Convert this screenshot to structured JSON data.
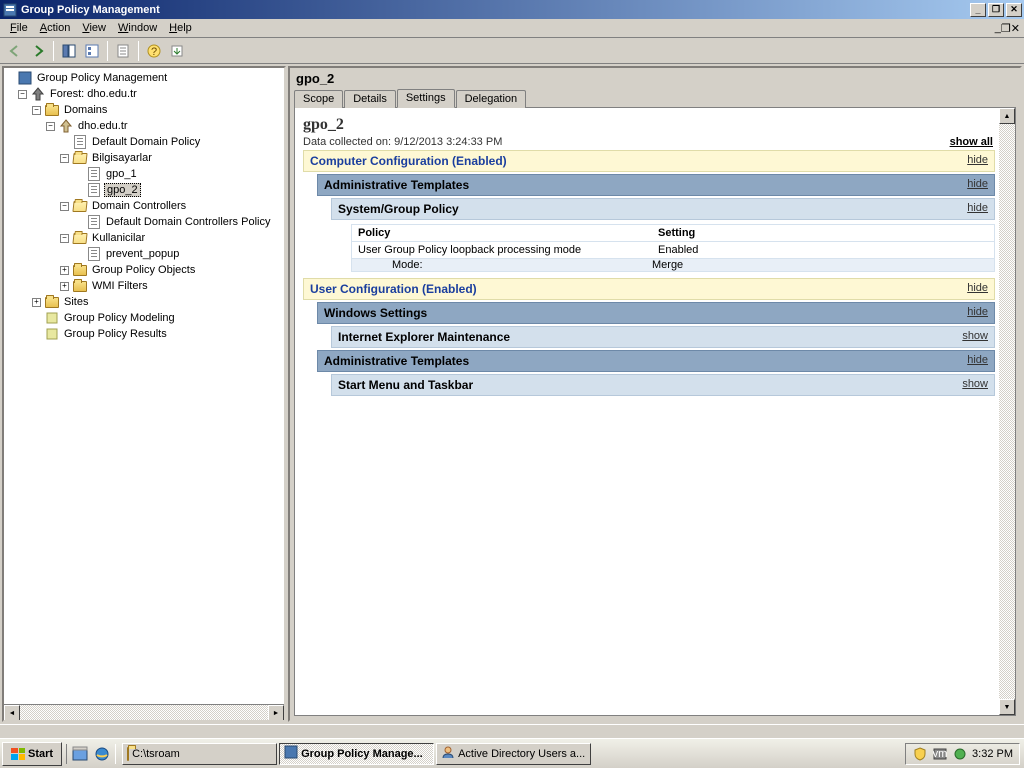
{
  "window": {
    "title": "Group Policy Management"
  },
  "menu": {
    "file": "File",
    "action": "Action",
    "view": "View",
    "window": "Window",
    "help": "Help"
  },
  "tree": {
    "root": "Group Policy Management",
    "forest": "Forest: dho.edu.tr",
    "domains": "Domains",
    "domain": "dho.edu.tr",
    "ddp": "Default Domain Policy",
    "ou1": "Bilgisayarlar",
    "gpo1": "gpo_1",
    "gpo2": "gpo_2",
    "dc": "Domain Controllers",
    "ddcp": "Default Domain Controllers Policy",
    "ou2": "Kullanicilar",
    "pp": "prevent_popup",
    "gpobj": "Group Policy Objects",
    "wmi": "WMI Filters",
    "sites": "Sites",
    "gpm": "Group Policy Modeling",
    "gpr": "Group Policy Results"
  },
  "right": {
    "title": "gpo_2",
    "tabs": {
      "scope": "Scope",
      "details": "Details",
      "settings": "Settings",
      "delegation": "Delegation"
    }
  },
  "report": {
    "heading": "gpo_2",
    "collected": "Data collected on: 9/12/2013 3:24:33 PM",
    "show_all": "show all",
    "hide": "hide",
    "show": "show",
    "comp_conf": "Computer Configuration (Enabled)",
    "admin_tpl": "Administrative Templates",
    "sys_gp": "System/Group Policy",
    "policy": "Policy",
    "setting": "Setting",
    "loopback": "User Group Policy loopback processing mode",
    "enabled": "Enabled",
    "mode": "Mode:",
    "merge": "Merge",
    "user_conf": "User Configuration (Enabled)",
    "win_settings": "Windows Settings",
    "ie_maint": "Internet Explorer Maintenance",
    "start_tb": "Start Menu and Taskbar"
  },
  "taskbar": {
    "start": "Start",
    "t1": "C:\\tsroam",
    "t2": "Group Policy Manage...",
    "t3": "Active Directory Users a...",
    "clock": "3:32 PM"
  }
}
